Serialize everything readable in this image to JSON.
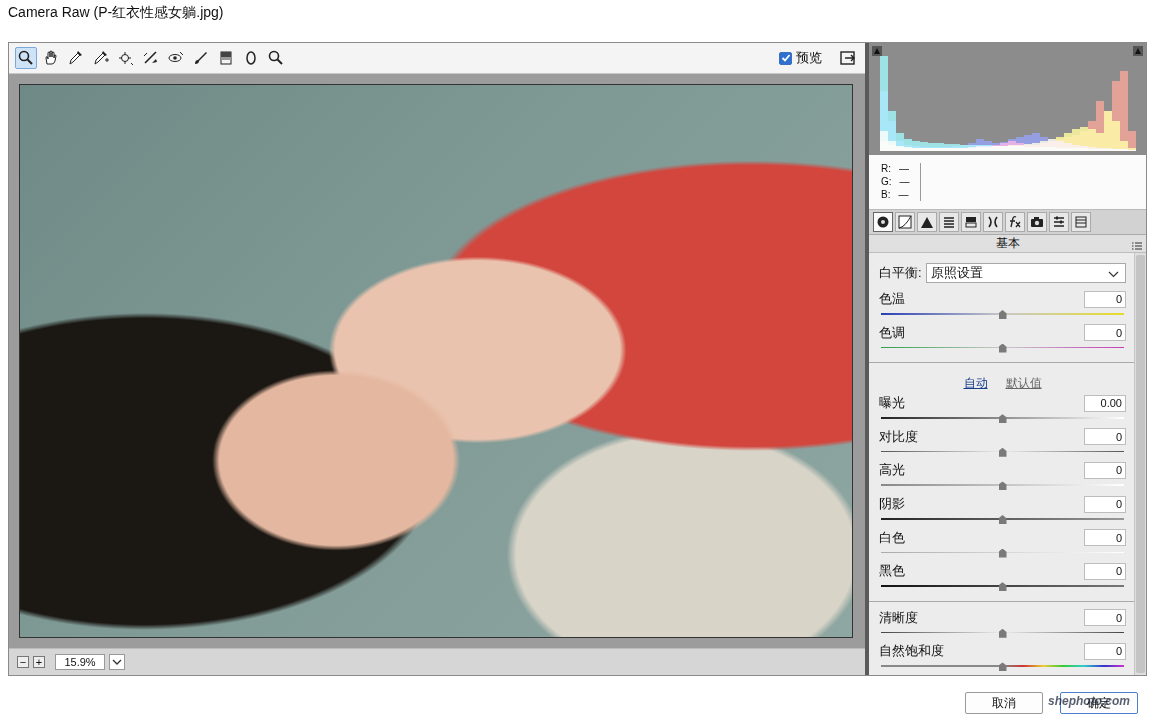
{
  "window": {
    "title": "Camera Raw (P-红衣性感女躺.jpg)"
  },
  "toolbar": {
    "tools": [
      {
        "selected": true
      },
      {
        "selected": false
      },
      {
        "selected": false
      },
      {
        "selected": false
      },
      {
        "selected": false
      },
      {
        "selected": false
      },
      {
        "selected": false
      },
      {
        "selected": false
      },
      {
        "selected": false
      },
      {
        "selected": false
      },
      {
        "selected": false
      }
    ],
    "preview": {
      "label": "预览",
      "checked": true
    }
  },
  "zoom": {
    "minus": "−",
    "plus": "+",
    "value": "15.9%"
  },
  "histogram": {
    "series": [
      {
        "name": "cyan",
        "color": "#33e0e8",
        "values": [
          95,
          40,
          18,
          12,
          10,
          9,
          8,
          8,
          7,
          7,
          6,
          6,
          6,
          6,
          5,
          5,
          5,
          5,
          4,
          4,
          4,
          4,
          3,
          3,
          3,
          3,
          2,
          2,
          2,
          2,
          2,
          1
        ]
      },
      {
        "name": "blue",
        "color": "#1a2fe0",
        "values": [
          60,
          30,
          10,
          6,
          5,
          4,
          4,
          4,
          4,
          5,
          6,
          8,
          12,
          10,
          8,
          9,
          12,
          14,
          16,
          18,
          14,
          12,
          10,
          8,
          6,
          5,
          4,
          3,
          3,
          2,
          2,
          1
        ]
      },
      {
        "name": "yellow",
        "color": "#f2ef2a",
        "values": [
          20,
          10,
          5,
          4,
          3,
          3,
          3,
          3,
          3,
          3,
          3,
          3,
          4,
          4,
          5,
          5,
          6,
          6,
          7,
          8,
          10,
          12,
          14,
          18,
          22,
          24,
          22,
          18,
          40,
          30,
          10,
          3
        ]
      },
      {
        "name": "red",
        "color": "#e43a1e",
        "values": [
          10,
          6,
          4,
          3,
          3,
          3,
          3,
          3,
          3,
          3,
          3,
          4,
          5,
          5,
          6,
          8,
          10,
          8,
          6,
          6,
          8,
          10,
          12,
          14,
          16,
          20,
          30,
          50,
          40,
          70,
          80,
          20
        ]
      }
    ]
  },
  "readout": [
    {
      "label": "R:",
      "value": "—"
    },
    {
      "label": "G:",
      "value": "—"
    },
    {
      "label": "B:",
      "value": "—"
    }
  ],
  "panel_tabs": [
    {
      "selected": true
    },
    {
      "selected": false
    },
    {
      "selected": false
    },
    {
      "selected": false
    },
    {
      "selected": false
    },
    {
      "selected": false
    },
    {
      "selected": false
    },
    {
      "selected": false
    },
    {
      "selected": false
    },
    {
      "selected": false
    }
  ],
  "panel": {
    "title": "基本",
    "rows": [
      {
        "kind": "dropdown",
        "label": "白平衡:",
        "value": "原照设置"
      },
      {
        "kind": "slider",
        "label": "色温",
        "value": "0",
        "level": 0.5
      },
      {
        "kind": "slider",
        "label": "色调",
        "value": "0",
        "level": 0.5
      },
      {
        "kind": "divider"
      },
      {
        "kind": "links",
        "auto": "自动",
        "default": "默认值"
      },
      {
        "kind": "slider",
        "label": "曝光",
        "value": "0.00",
        "level": 0.5
      },
      {
        "kind": "slider",
        "label": "对比度",
        "value": "0",
        "level": 0.5
      },
      {
        "kind": "slider",
        "label": "高光",
        "value": "0",
        "level": 0.5
      },
      {
        "kind": "slider",
        "label": "阴影",
        "value": "0",
        "level": 0.5
      },
      {
        "kind": "slider",
        "label": "白色",
        "value": "0",
        "level": 0.5
      },
      {
        "kind": "slider",
        "label": "黑色",
        "value": "0",
        "level": 0.5
      },
      {
        "kind": "divider"
      },
      {
        "kind": "slider",
        "label": "清晰度",
        "value": "0",
        "level": 0.5
      },
      {
        "kind": "slider",
        "label": "自然饱和度",
        "value": "0",
        "level": 0.5
      }
    ]
  },
  "buttons": [
    "取消",
    "确定"
  ],
  "watermark": "shephoto.com"
}
